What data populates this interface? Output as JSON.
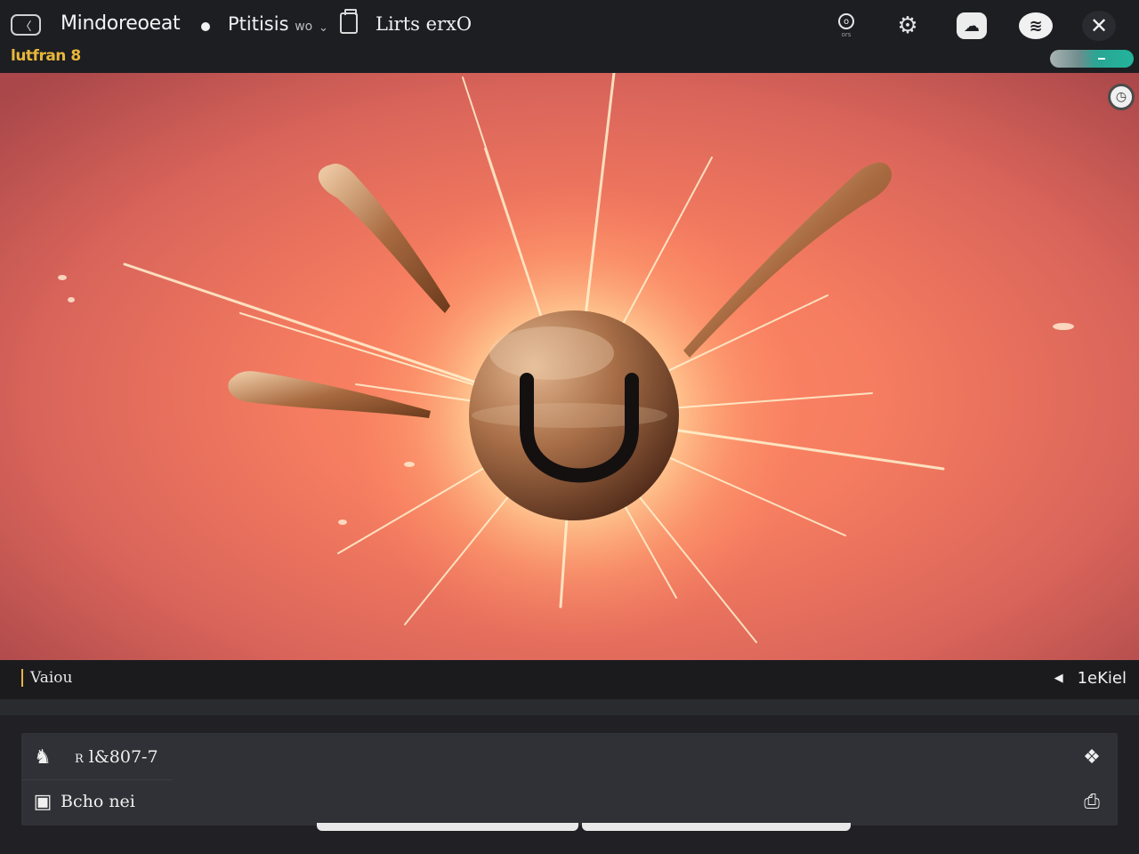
{
  "window": {
    "title": "Mindoreoeat",
    "subtitle": "lutfran 8"
  },
  "breadcrumbs": [
    {
      "label": "Ptitisis",
      "suffix": "wo"
    },
    {
      "label": "Lirts erxO"
    }
  ],
  "toolbar": {
    "icons": [
      {
        "name": "timer-icon",
        "caption": "ors"
      },
      {
        "name": "robot-icon"
      },
      {
        "name": "cloud-icon"
      },
      {
        "name": "chat-icon"
      },
      {
        "name": "close-icon"
      }
    ]
  },
  "toggle": {
    "state": "on"
  },
  "status": {
    "left_label": "Vaiou",
    "right_value": "1eKiel"
  },
  "panel": {
    "rows": [
      {
        "icon": "user-icon",
        "prefix": "R",
        "text": "l&807-7",
        "trail_icon": "location-icon"
      },
      {
        "icon": "profile-icon",
        "text": "Bcho nei",
        "trail_icon": "printer-icon"
      }
    ]
  },
  "colors": {
    "accent_gold": "#e8b73a",
    "toggle_teal": "#22b49b",
    "background": "#1d1e22",
    "hero_orange": "#f67d60"
  }
}
